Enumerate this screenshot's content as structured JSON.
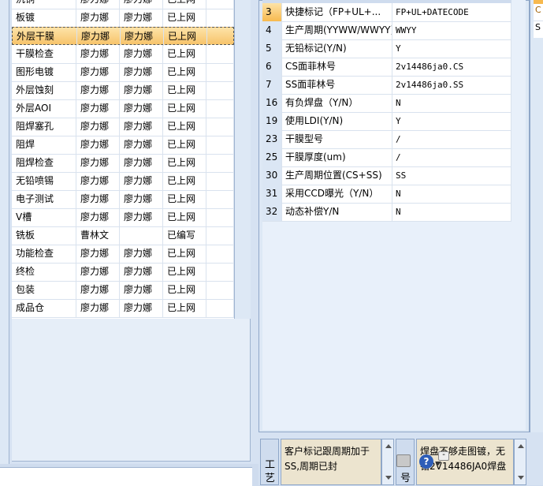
{
  "left_grid": {
    "rows": [
      {
        "c0": "沉铜",
        "c1": "廖力娜",
        "c2": "廖力娜",
        "c3": "已上网",
        "selected": false
      },
      {
        "c0": "板镀",
        "c1": "廖力娜",
        "c2": "廖力娜",
        "c3": "已上网",
        "selected": false
      },
      {
        "c0": "外层干膜",
        "c1": "廖力娜",
        "c2": "廖力娜",
        "c3": "已上网",
        "selected": true
      },
      {
        "c0": "干膜检查",
        "c1": "廖力娜",
        "c2": "廖力娜",
        "c3": "已上网",
        "selected": false
      },
      {
        "c0": "图形电镀",
        "c1": "廖力娜",
        "c2": "廖力娜",
        "c3": "已上网",
        "selected": false
      },
      {
        "c0": "外层蚀刻",
        "c1": "廖力娜",
        "c2": "廖力娜",
        "c3": "已上网",
        "selected": false
      },
      {
        "c0": "外层AOI",
        "c1": "廖力娜",
        "c2": "廖力娜",
        "c3": "已上网",
        "selected": false
      },
      {
        "c0": "阻焊塞孔",
        "c1": "廖力娜",
        "c2": "廖力娜",
        "c3": "已上网",
        "selected": false
      },
      {
        "c0": "阻焊",
        "c1": "廖力娜",
        "c2": "廖力娜",
        "c3": "已上网",
        "selected": false
      },
      {
        "c0": "阻焊检查",
        "c1": "廖力娜",
        "c2": "廖力娜",
        "c3": "已上网",
        "selected": false
      },
      {
        "c0": "无铅喷锡",
        "c1": "廖力娜",
        "c2": "廖力娜",
        "c3": "已上网",
        "selected": false
      },
      {
        "c0": "电子测试",
        "c1": "廖力娜",
        "c2": "廖力娜",
        "c3": "已上网",
        "selected": false
      },
      {
        "c0": "V槽",
        "c1": "廖力娜",
        "c2": "廖力娜",
        "c3": "已上网",
        "selected": false
      },
      {
        "c0": "铣板",
        "c1": "曹林文",
        "c2": "",
        "c3": "已编写",
        "selected": false
      },
      {
        "c0": "功能检查",
        "c1": "廖力娜",
        "c2": "廖力娜",
        "c3": "已上网",
        "selected": false
      },
      {
        "c0": "终检",
        "c1": "廖力娜",
        "c2": "廖力娜",
        "c3": "已上网",
        "selected": false
      },
      {
        "c0": "包装",
        "c1": "廖力娜",
        "c2": "廖力娜",
        "c3": "已上网",
        "selected": false
      },
      {
        "c0": "成品仓",
        "c1": "廖力娜",
        "c2": "廖力娜",
        "c3": "已上网",
        "selected": false
      }
    ]
  },
  "param_grid": {
    "rows": [
      {
        "no": "3",
        "name": "快捷标记（FP+UL+...",
        "value": "FP+UL+DATECODE",
        "current": true
      },
      {
        "no": "4",
        "name": "生产周期(YYWW/WWYY)",
        "value": "WWYY",
        "current": false
      },
      {
        "no": "5",
        "name": "无铅标记(Y/N)",
        "value": "Y",
        "current": false
      },
      {
        "no": "6",
        "name": "CS面菲林号",
        "value": "2v14486ja0.CS",
        "current": false
      },
      {
        "no": "7",
        "name": "SS面菲林号",
        "value": "2v14486ja0.SS",
        "current": false
      },
      {
        "no": "16",
        "name": "有负焊盘（Y/N）",
        "value": "N",
        "current": false
      },
      {
        "no": "19",
        "name": "使用LDI(Y/N)",
        "value": "Y",
        "current": false
      },
      {
        "no": "23",
        "name": "干膜型号",
        "value": "/",
        "current": false
      },
      {
        "no": "25",
        "name": "干膜厚度(um)",
        "value": "/",
        "current": false
      },
      {
        "no": "30",
        "name": "生产周期位置(CS+SS)",
        "value": "SS",
        "current": false
      },
      {
        "no": "31",
        "name": "采用CCD曝光（Y/N）",
        "value": "N",
        "current": false
      },
      {
        "no": "32",
        "name": "动态补偿Y/N",
        "value": "N",
        "current": false
      }
    ]
  },
  "right_panel": {
    "r1": "C",
    "r2": "S"
  },
  "bottom": {
    "tab1_label": "工艺",
    "memo1": "客户标记跟周期加于SS,周期已封",
    "tab2_label": "号",
    "memo2": "焊盘不够走图镀，无铅2V14486JA0焊盘",
    "help_label": "?",
    "mini_label": "-"
  },
  "colors": {
    "selected_row": "#f7c46b",
    "memo_bg": "#ece4cf",
    "panel_bg": "#dde8f5"
  }
}
